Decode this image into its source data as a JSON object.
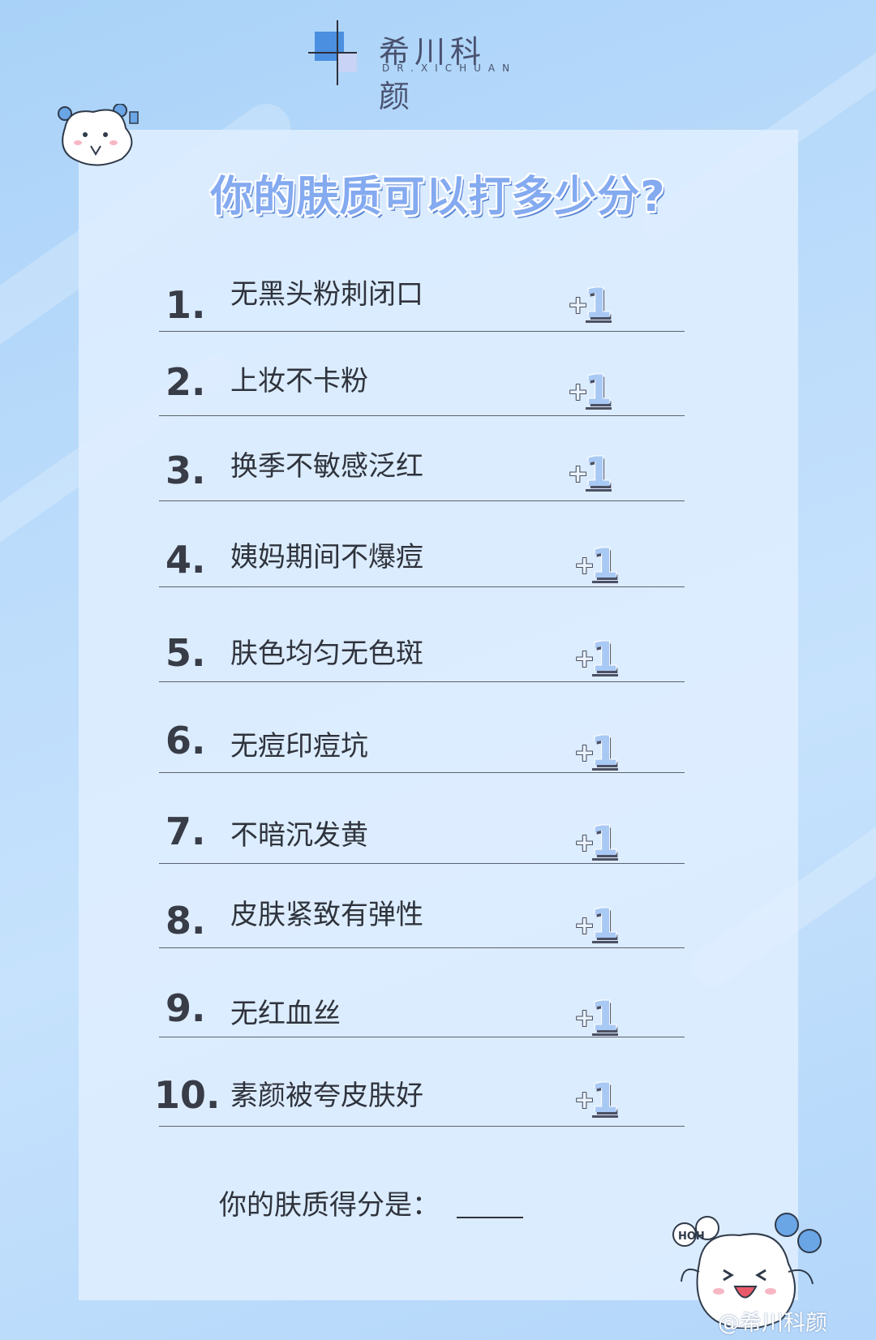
{
  "brand": {
    "name_cn": "希川科颜",
    "name_en": "DR.XICHUAN"
  },
  "title": "你的肤质可以打多少分?",
  "items": [
    {
      "number": "1.",
      "text": "无黑头粉刺闭口",
      "badge": "+1"
    },
    {
      "number": "2.",
      "text": "上妆不卡粉",
      "badge": "+1"
    },
    {
      "number": "3.",
      "text": "换季不敏感泛红",
      "badge": "+1"
    },
    {
      "number": "4.",
      "text": "姨妈期间不爆痘",
      "badge": "+1"
    },
    {
      "number": "5.",
      "text": "肤色均匀无色斑",
      "badge": "+1"
    },
    {
      "number": "6.",
      "text": "无痘印痘坑",
      "badge": "+1"
    },
    {
      "number": "7.",
      "text": "不暗沉发黄",
      "badge": "+1"
    },
    {
      "number": "8.",
      "text": "皮肤紧致有弹性",
      "badge": "+1"
    },
    {
      "number": "9.",
      "text": "无红血丝",
      "badge": "+1"
    },
    {
      "number": "10.",
      "text": "素颜被夸皮肤好",
      "badge": "+1"
    }
  ],
  "score_label": "你的肤质得分是：",
  "mascot_text": "HOH",
  "watermark": "@希川科颜",
  "colors": {
    "background": "#bcdcfb",
    "card": "#e0efff",
    "title": "#84aaf0",
    "logo_blue": "#4a8fe0"
  }
}
